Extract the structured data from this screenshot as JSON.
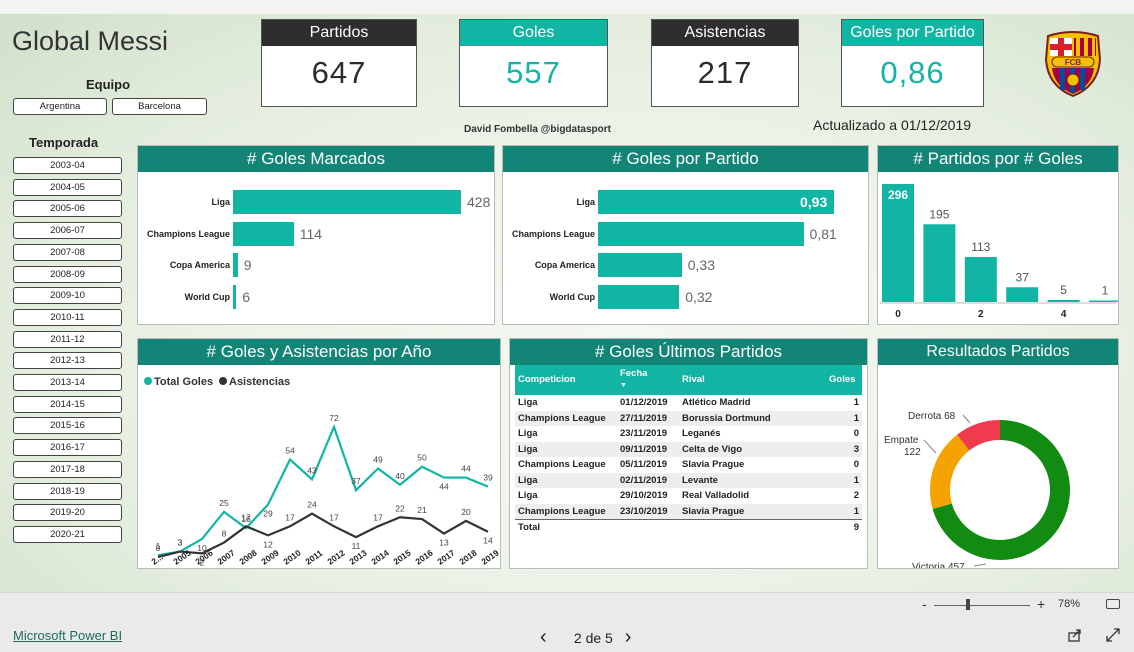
{
  "app_title": "Global Messi",
  "kpis": [
    {
      "label": "Partidos",
      "value": "647",
      "style": "dark"
    },
    {
      "label": "Goles",
      "value": "557",
      "style": "teal"
    },
    {
      "label": "Asistencias",
      "value": "217",
      "style": "dark"
    },
    {
      "label": "Goles por Partido",
      "value": "0,86",
      "style": "teal"
    }
  ],
  "logo": {
    "text": "FCB",
    "icon": "fc-barcelona-crest-icon"
  },
  "equipo": {
    "label": "Equipo",
    "options": [
      "Argentina",
      "Barcelona"
    ]
  },
  "temporada": {
    "label": "Temporada",
    "options": [
      "2003-04",
      "2004-05",
      "2005-06",
      "2006-07",
      "2007-08",
      "2008-09",
      "2009-10",
      "2010-11",
      "2011-12",
      "2012-13",
      "2013-14",
      "2014-15",
      "2015-16",
      "2016-17",
      "2017-18",
      "2018-19",
      "2019-20",
      "2020-21"
    ]
  },
  "credit": "David Fombella @bigdatasport",
  "updated": "Actualizado a 01/12/2019",
  "goles_marcados": {
    "title": "# Goles Marcados",
    "chart_data": {
      "type": "bar",
      "categories": [
        "Liga",
        "Champions League",
        "Copa America",
        "World Cup"
      ],
      "values": [
        428,
        114,
        9,
        6
      ]
    }
  },
  "goles_por_partido": {
    "title": "# Goles por Partido",
    "chart_data": {
      "type": "bar",
      "categories": [
        "Liga",
        "Champions League",
        "Copa America",
        "World Cup"
      ],
      "values": [
        0.93,
        0.81,
        0.33,
        0.32
      ],
      "value_labels": [
        "0,93",
        "0,81",
        "0,33",
        "0,32"
      ]
    }
  },
  "partidos_por_goles": {
    "title": "# Partidos por # Goles",
    "chart_data": {
      "type": "bar",
      "x": [
        0,
        1,
        2,
        3,
        4,
        5
      ],
      "values": [
        296,
        195,
        113,
        37,
        5,
        1
      ],
      "x_tick_labels": [
        "0",
        "2",
        "4"
      ]
    }
  },
  "goles_asistencias": {
    "title": "# Goles y Asistencias por Año",
    "chart_data": {
      "type": "line",
      "categories": [
        "2...",
        "2005",
        "2006",
        "2007",
        "2008",
        "2009",
        "2010",
        "2011",
        "2012",
        "2013",
        "2014",
        "2015",
        "2016",
        "2017",
        "2018",
        "2019"
      ],
      "series": [
        {
          "name": "Total Goles",
          "color": "#12b5a3",
          "values": [
            1,
            3,
            10,
            25,
            16,
            29,
            54,
            43,
            72,
            37,
            49,
            40,
            50,
            44,
            44,
            39
          ]
        },
        {
          "name": "Asistencias",
          "color": "#333333",
          "values": [
            0,
            3,
            2,
            8,
            17,
            12,
            17,
            24,
            17,
            11,
            17,
            22,
            21,
            13,
            20,
            14
          ]
        }
      ]
    }
  },
  "ultimos_partidos": {
    "title": "# Goles Últimos Partidos",
    "columns": [
      "Competicion",
      "Fecha",
      "Rival",
      "Goles"
    ],
    "rows": [
      [
        "Liga",
        "01/12/2019",
        "Atlético Madrid",
        "1"
      ],
      [
        "Champions League",
        "27/11/2019",
        "Borussia Dortmund",
        "1"
      ],
      [
        "Liga",
        "23/11/2019",
        "Leganés",
        "0"
      ],
      [
        "Liga",
        "09/11/2019",
        "Celta de Vigo",
        "3"
      ],
      [
        "Champions League",
        "05/11/2019",
        "Slavia Prague",
        "0"
      ],
      [
        "Liga",
        "02/11/2019",
        "Levante",
        "1"
      ],
      [
        "Liga",
        "29/10/2019",
        "Real Valladolid",
        "2"
      ],
      [
        "Champions League",
        "23/10/2019",
        "Slavia Prague",
        "1"
      ]
    ],
    "total_label": "Total",
    "total_value": "9"
  },
  "resultados": {
    "title": "Resultados Partidos",
    "chart_data": {
      "type": "pie",
      "slices": [
        {
          "label": "Victoria",
          "value": 457,
          "color": "#128b12"
        },
        {
          "label": "Empate",
          "value": 122,
          "color": "#f5a300"
        },
        {
          "label": "Derrota",
          "value": 68,
          "color": "#ef3b4d"
        }
      ]
    }
  },
  "zoom": {
    "minus": "-",
    "plus": "+",
    "level": "78%"
  },
  "footer": {
    "link": "Microsoft Power BI",
    "page": "2 de 5",
    "prev": "‹",
    "next": "›"
  },
  "colors": {
    "teal": "#12b5a3",
    "dark_teal": "#138576",
    "dark": "#2e2e2e"
  }
}
